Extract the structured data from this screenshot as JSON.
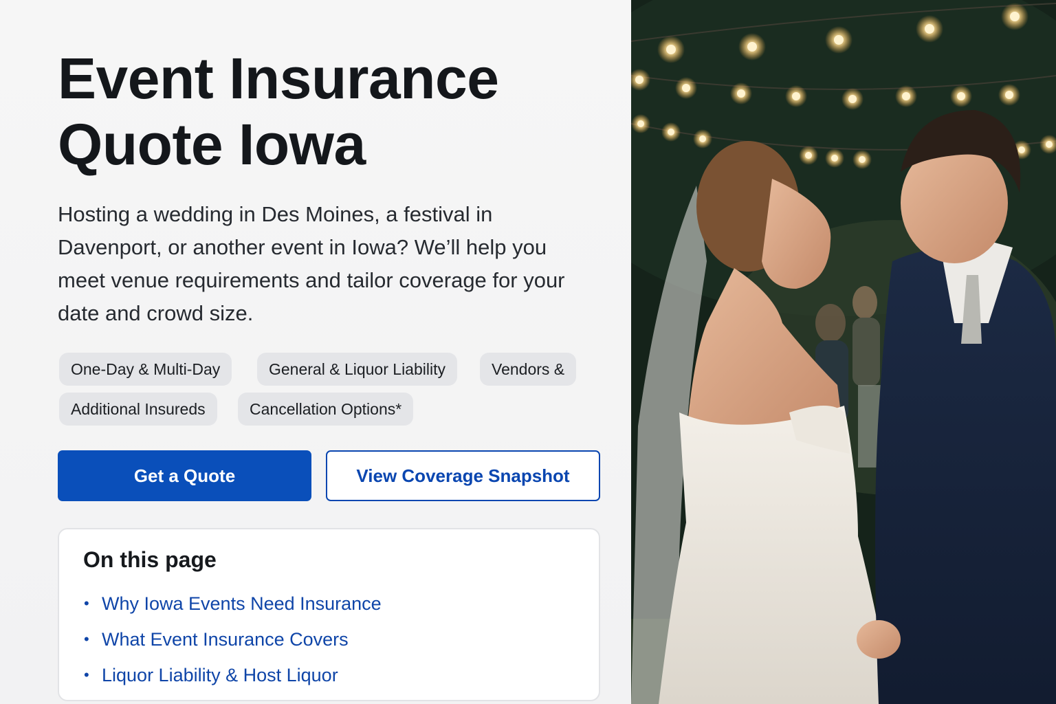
{
  "hero": {
    "title_line1": "Event Insurance",
    "title_line2": "Quote Iowa",
    "intro": "Hosting a wedding in Des Moines, a festival in Davenport, or another event in Iowa? We’ll help you meet venue requirements and tailor coverage for your date and crowd size."
  },
  "chips": [
    "One-Day & Multi-Day",
    "General & Liquor Liability",
    "Vendors &",
    "Additional Insureds",
    "Cancellation Options*"
  ],
  "buttons": {
    "primary": "Get a Quote",
    "secondary": "View Coverage Snapshot"
  },
  "toc": {
    "title": "On this page",
    "items": [
      "Why Iowa Events Need Insurance",
      "What Event Insurance Covers",
      "Liquor Liability & Host Liquor"
    ]
  },
  "colors": {
    "primary": "#0a4fba",
    "link": "#0f45a8",
    "chip_bg": "#e4e5e8"
  },
  "photo": {
    "icon": "wedding-couple-photo"
  }
}
